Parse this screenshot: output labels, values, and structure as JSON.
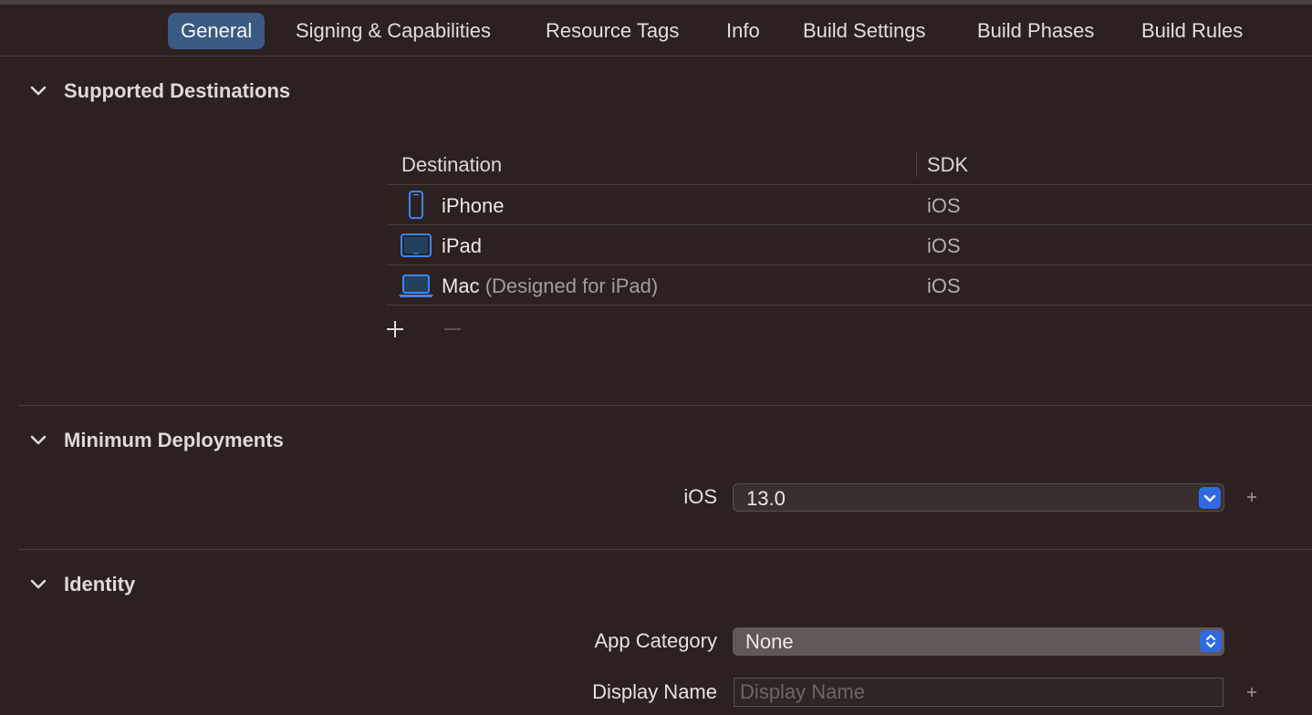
{
  "tabs": [
    {
      "label": "General",
      "active": true
    },
    {
      "label": "Signing & Capabilities"
    },
    {
      "label": "Resource Tags"
    },
    {
      "label": "Info"
    },
    {
      "label": "Build Settings"
    },
    {
      "label": "Build Phases"
    },
    {
      "label": "Build Rules"
    }
  ],
  "supported_destinations": {
    "title": "Supported Destinations",
    "columns": {
      "destination": "Destination",
      "sdk": "SDK"
    },
    "rows": [
      {
        "icon": "iphone-icon",
        "name": "iPhone",
        "note": "",
        "sdk": "iOS"
      },
      {
        "icon": "ipad-icon",
        "name": "iPad",
        "note": "",
        "sdk": "iOS"
      },
      {
        "icon": "mac-icon",
        "name": "Mac",
        "note": "(Designed for iPad)",
        "sdk": "iOS"
      }
    ],
    "add_symbol": "+",
    "remove_symbol": "—"
  },
  "minimum_deployments": {
    "title": "Minimum Deployments",
    "platform_label": "iOS",
    "version_value": "13.0"
  },
  "identity": {
    "title": "Identity",
    "app_category_label": "App Category",
    "app_category_value": "None",
    "display_name_label": "Display Name",
    "display_name_placeholder": "Display Name",
    "display_name_value": ""
  },
  "colors": {
    "background": "#2d2020",
    "active_tab": "#3b5b82",
    "accent_blue": "#2f6be0",
    "device_icon_blue": "#3a86f4"
  }
}
